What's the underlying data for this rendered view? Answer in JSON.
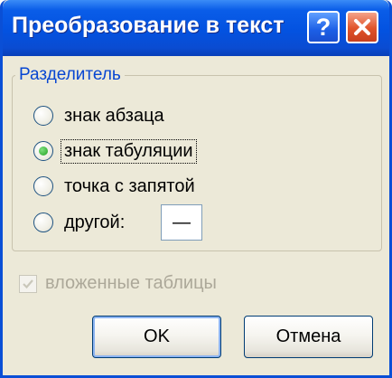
{
  "dialog": {
    "title": "Преобразование в текст",
    "help_label": "?"
  },
  "separator_group": {
    "label": "Разделитель",
    "options": [
      {
        "label": "знак абзаца",
        "selected": false
      },
      {
        "label": "знак табуляции",
        "selected": true
      },
      {
        "label": "точка с запятой",
        "selected": false
      },
      {
        "label": "другой:",
        "selected": false
      }
    ],
    "other_value": "—"
  },
  "nested_tables": {
    "label": "вложенные таблицы",
    "checked": true,
    "enabled": false
  },
  "buttons": {
    "ok": "OK",
    "cancel": "Отмена"
  },
  "colors": {
    "title_bar": "#0352e0",
    "group_label": "#0746d2",
    "dialog_bg": "#ece9d8",
    "close_button": "#e0532a"
  }
}
